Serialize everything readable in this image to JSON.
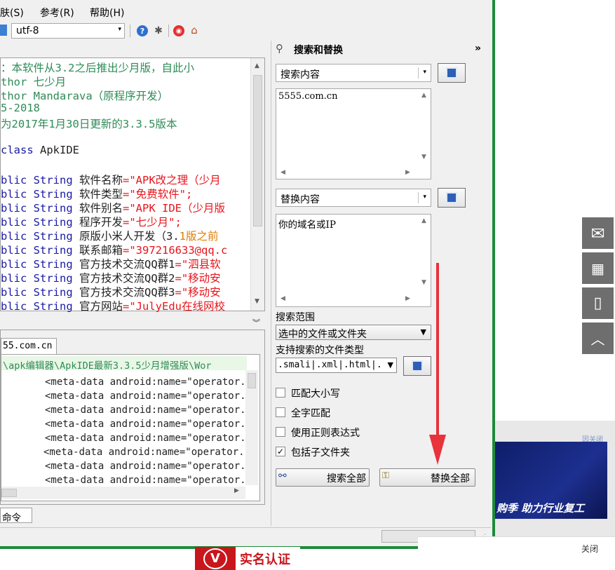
{
  "menu": [
    "肤(S)",
    "参考(R)",
    "帮助(H)"
  ],
  "toolbar": {
    "encoding": "utf-8"
  },
  "editor": {
    "lines": [
      [
        {
          "t": "：本软件从3.2之后推出少月版，自此小",
          "c": "c-green"
        }
      ],
      [
        {
          "t": "thor 七少月",
          "c": "c-green"
        }
      ],
      [
        {
          "t": "thor Mandarava（原程序开发）",
          "c": "c-green"
        }
      ],
      [
        {
          "t": "5-2018",
          "c": "c-green"
        }
      ],
      [
        {
          "t": "为2017年1月30日更新的3.3.5版本",
          "c": "c-green"
        }
      ],
      [],
      [
        {
          "t": " class ",
          "c": "c-blue"
        },
        {
          "t": "ApkIDE",
          "c": "c-black"
        }
      ],
      [],
      [
        {
          "t": "blic String ",
          "c": "c-blue"
        },
        {
          "t": "软件名称",
          "c": "c-black"
        },
        {
          "t": "=\"APK改之理（少月",
          "c": "c-red"
        }
      ],
      [
        {
          "t": "blic String ",
          "c": "c-blue"
        },
        {
          "t": "软件类型",
          "c": "c-black"
        },
        {
          "t": "=\"免费软件\";",
          "c": "c-red"
        }
      ],
      [
        {
          "t": "blic String ",
          "c": "c-blue"
        },
        {
          "t": "软件别名",
          "c": "c-black"
        },
        {
          "t": "=\"APK IDE（少月版",
          "c": "c-red"
        }
      ],
      [
        {
          "t": "blic String ",
          "c": "c-blue"
        },
        {
          "t": "程序开发",
          "c": "c-black"
        },
        {
          "t": "=\"七少月\";",
          "c": "c-red"
        }
      ],
      [
        {
          "t": "blic String ",
          "c": "c-blue"
        },
        {
          "t": "原版小米人开发（3.",
          "c": "c-black"
        },
        {
          "t": "1版之前",
          "c": "c-orange"
        }
      ],
      [
        {
          "t": "blic String ",
          "c": "c-blue"
        },
        {
          "t": "联系邮箱",
          "c": "c-black"
        },
        {
          "t": "=\"397216633@qq.c",
          "c": "c-red"
        }
      ],
      [
        {
          "t": "blic String ",
          "c": "c-blue"
        },
        {
          "t": "官方技术交流QQ群1",
          "c": "c-black"
        },
        {
          "t": "=\"泗县软",
          "c": "c-red"
        }
      ],
      [
        {
          "t": "blic String ",
          "c": "c-blue"
        },
        {
          "t": "官方技术交流QQ群2",
          "c": "c-black"
        },
        {
          "t": "=\"移动安",
          "c": "c-red"
        }
      ],
      [
        {
          "t": "blic String ",
          "c": "c-blue"
        },
        {
          "t": "官方技术交流QQ群3",
          "c": "c-black"
        },
        {
          "t": "=\"移动安",
          "c": "c-red"
        }
      ],
      [
        {
          "t": "blic String ",
          "c": "c-blue"
        },
        {
          "t": "官方网站",
          "c": "c-black"
        },
        {
          "t": "=\"JulyEdu在线网校",
          "c": "c-red"
        }
      ]
    ]
  },
  "results": {
    "tab": "55.com.cn",
    "path": "\\apk编辑器\\ApkIDE最新3.3.5少月增强版\\Wor",
    "lines": [
      "<meta-data android:name=\"operator.u",
      "<meta-data android:name=\"operator.u",
      "<meta-data android:name=\"operator.u",
      "<meta-data android:name=\"operator.u",
      "<meta-data android:name=\"operator.a",
      "<meta-data android:name=\"operator.c",
      "<meta-data android:name=\"operator.c",
      "<meta-data android:name=\"operator.c"
    ]
  },
  "bottom_tab": "命令",
  "panel": {
    "title": "搜索和替换",
    "collapse": "»",
    "search_label": "搜索内容",
    "search_text": "5555.com.cn",
    "replace_label": "替换内容",
    "replace_text": "你的域名或IP",
    "scope_label": "搜索范围",
    "scope_value": "选中的文件或文件夹",
    "types_label": "支持搜索的文件类型",
    "types_value": ".smali|.xml|.html|.",
    "options": [
      {
        "label": "匹配大小写",
        "checked": false
      },
      {
        "label": "全字匹配",
        "checked": false
      },
      {
        "label": "使用正则表达式",
        "checked": false
      },
      {
        "label": "包括子文件夹",
        "checked": true
      }
    ],
    "search_all": "搜索全部",
    "replace_all": "替换全部"
  },
  "web": {
    "banner_text": "购季 助力行业复工",
    "close_text": "关闭",
    "close_small": "因关闭",
    "badge_text": "实名认证",
    "badge_char": "V"
  },
  "colors": {
    "arrow": "#e8323c",
    "window_border": "#1f8a3a"
  }
}
